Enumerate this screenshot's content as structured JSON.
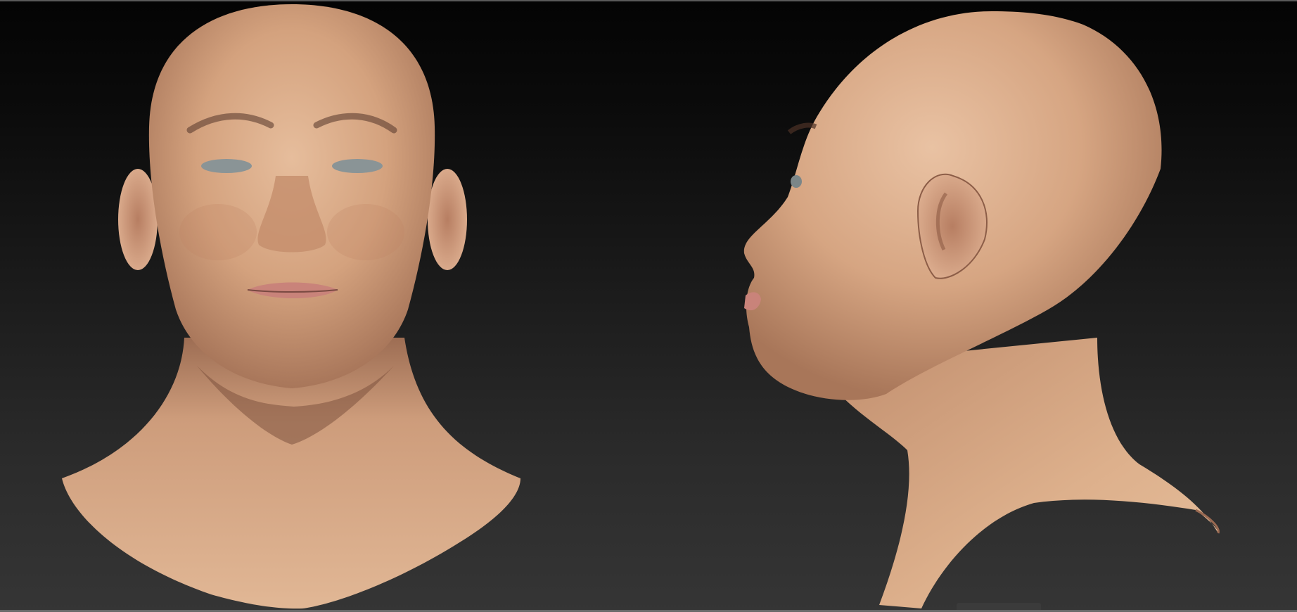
{
  "viewport": {
    "background_top": "#040404",
    "background_bottom": "#353535"
  },
  "models": [
    {
      "id": "front",
      "view": "front"
    },
    {
      "id": "side",
      "view": "side"
    }
  ],
  "colors": {
    "skin_light": "#e2b796",
    "skin_mid": "#c99572",
    "skin_dark": "#8f6048",
    "lip": "#c9837a",
    "eye": "#8a9496"
  }
}
